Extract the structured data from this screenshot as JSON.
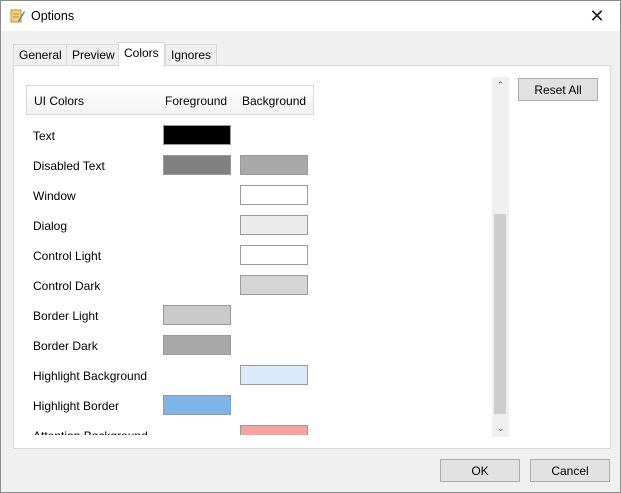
{
  "window": {
    "title": "Options",
    "close_glyph": "✕"
  },
  "tabs": [
    {
      "label": "General"
    },
    {
      "label": "Preview"
    },
    {
      "label": "Colors",
      "active": true
    },
    {
      "label": "Ignores"
    }
  ],
  "table": {
    "headers": {
      "name": "UI Colors",
      "foreground": "Foreground",
      "background": "Background"
    },
    "rows": [
      {
        "label": "Text",
        "foreground": "#000000",
        "background": null
      },
      {
        "label": "Disabled Text",
        "foreground": "#808080",
        "background": "#a9a9a9"
      },
      {
        "label": "Window",
        "foreground": null,
        "background": "#ffffff"
      },
      {
        "label": "Dialog",
        "foreground": null,
        "background": "#ebebeb"
      },
      {
        "label": "Control Light",
        "foreground": null,
        "background": "#ffffff"
      },
      {
        "label": "Control Dark",
        "foreground": null,
        "background": "#d5d5d5"
      },
      {
        "label": "Border Light",
        "foreground": "#cacaca",
        "background": null
      },
      {
        "label": "Border Dark",
        "foreground": "#a8a8a8",
        "background": null
      },
      {
        "label": "Highlight Background",
        "foreground": null,
        "background": "#daeafb"
      },
      {
        "label": "Highlight Border",
        "foreground": "#7eb4ea",
        "background": null
      },
      {
        "label": "Attention Background",
        "foreground": null,
        "background": "#f7a1a1"
      }
    ]
  },
  "buttons": {
    "reset_all": "Reset All",
    "ok": "OK",
    "cancel": "Cancel"
  },
  "scrollbar": {
    "up_glyph": "⌃",
    "down_glyph": "⌄"
  }
}
